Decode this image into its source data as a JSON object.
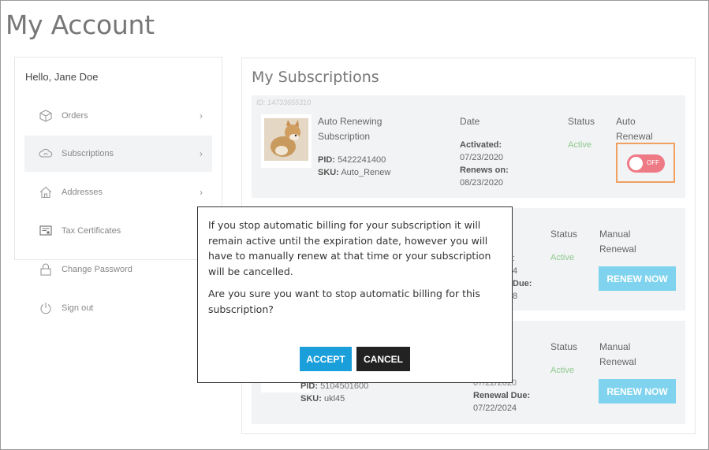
{
  "page": {
    "title": "My Account"
  },
  "sidebar": {
    "greeting": "Hello, Jane Doe",
    "items": [
      {
        "label": "Orders",
        "icon": "box-icon",
        "chevron": "›"
      },
      {
        "label": "Subscriptions",
        "icon": "cloud-sync-icon",
        "chevron": "›"
      },
      {
        "label": "Addresses",
        "icon": "home-icon",
        "chevron": "›"
      },
      {
        "label": "Tax Certificates",
        "icon": "certificate-icon",
        "chevron": ""
      },
      {
        "label": "Change Password",
        "icon": "lock-icon",
        "chevron": ""
      },
      {
        "label": "Sign out",
        "icon": "power-icon",
        "chevron": ""
      }
    ]
  },
  "main": {
    "title": "My Subscriptions",
    "subscriptions": [
      {
        "id": "ID: 14733655310",
        "name_line1": "Auto Renewing",
        "name_line2": "Subscription",
        "pid_label": "PID:",
        "pid": "5422241400",
        "sku_label": "SKU:",
        "sku": "Auto_Renew",
        "date_header": "Date",
        "activated_label": "Activated:",
        "activated": "07/23/2020",
        "renews_label": "Renews on:",
        "renews": "08/23/2020",
        "status_header": "Status",
        "status": "Active",
        "renewal_header_line1": "Auto",
        "renewal_header_line2": "Renewal",
        "toggle_label": "OFF"
      },
      {
        "partial_a": "4",
        "partial_b": "Due:",
        "partial_c": "8",
        "partial_d": ":",
        "status_header": "Status",
        "status": "Active",
        "renewal_header_line1": "Manual",
        "renewal_header_line2": "Renewal",
        "button": "RENEW NOW"
      },
      {
        "pid_label": "PID:",
        "pid": "5104501600",
        "sku_label": "SKU:",
        "sku": "ukl45",
        "activated": "07/22/2020",
        "renews_label": "Renewal Due:",
        "renews": "07/22/2024",
        "status_header": "Status",
        "status": "Active",
        "renewal_header_line1": "Manual",
        "renewal_header_line2": "Renewal",
        "button": "RENEW NOW"
      }
    ]
  },
  "modal": {
    "message": "If you stop automatic billing for your subscription it will remain active until the expiration date, however you will have to manually renew at that time or your subscription will be cancelled.",
    "question": "Are you sure you want to stop automatic billing for this subscription?",
    "accept": "ACCEPT",
    "cancel": "CANCEL"
  },
  "colors": {
    "accent_blue": "#1a9fdb",
    "renew_button": "#7fd3ee",
    "toggle_off": "#ee7a85",
    "active_status": "#8fc98f",
    "highlight_border": "#f0a060"
  }
}
